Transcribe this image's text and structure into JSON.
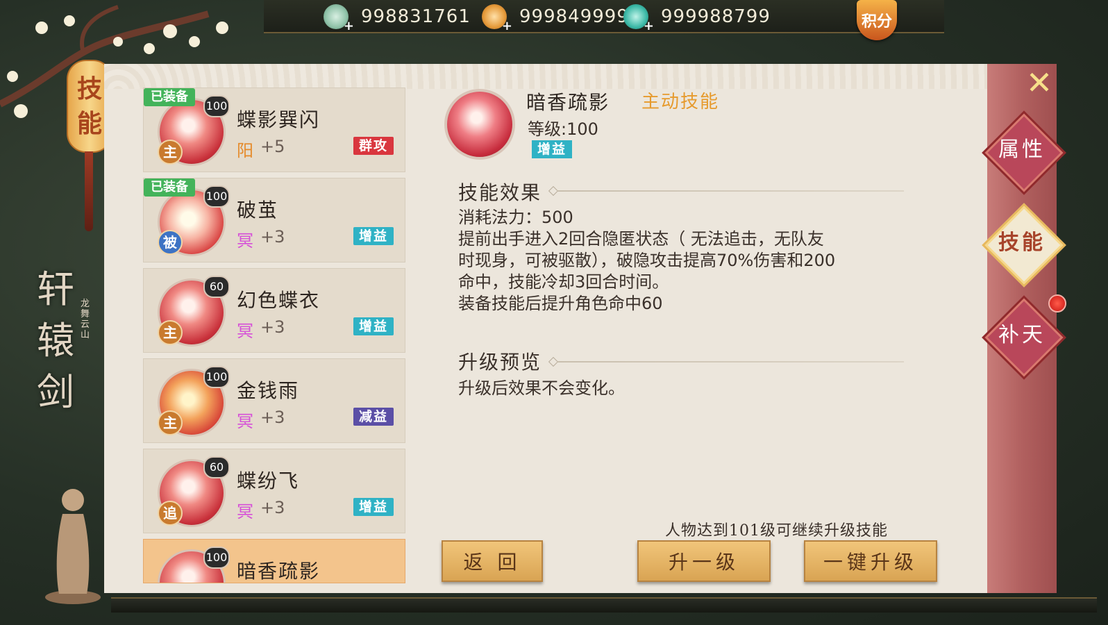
{
  "currencies": [
    {
      "value": "998831761",
      "color": "#8fc2a8"
    },
    {
      "value": "999849999",
      "color": "#e59a3a"
    },
    {
      "value": "999988799",
      "color": "#3bb8a6"
    }
  ],
  "top_badge": "积分",
  "lantern": [
    "技",
    "能"
  ],
  "logo": {
    "title": [
      "轩",
      "辕",
      "剑"
    ],
    "subtitle": "龙舞云山"
  },
  "side_tabs": [
    {
      "label": "属性",
      "active": false
    },
    {
      "label": "技能",
      "active": true
    },
    {
      "label": "补天",
      "active": false
    }
  ],
  "skills": [
    {
      "name": "蝶影巽闪",
      "level": "100",
      "equipped": "已装备",
      "type": "主",
      "element": "阳",
      "element_color": "#e58a2a",
      "bonus": "+5",
      "tag": "群攻",
      "tag_color": "#d9363e"
    },
    {
      "name": "破茧",
      "level": "100",
      "equipped": "已装备",
      "type": "被",
      "element": "冥",
      "element_color": "#d64fd8",
      "bonus": "+3",
      "tag": "增益",
      "tag_color": "#2fb2c5"
    },
    {
      "name": "幻色蝶衣",
      "level": "60",
      "equipped": "",
      "type": "主",
      "element": "冥",
      "element_color": "#d64fd8",
      "bonus": "+3",
      "tag": "增益",
      "tag_color": "#2fb2c5"
    },
    {
      "name": "金钱雨",
      "level": "100",
      "equipped": "",
      "type": "主",
      "element": "冥",
      "element_color": "#d64fd8",
      "bonus": "+3",
      "tag": "减益",
      "tag_color": "#5b4fa6"
    },
    {
      "name": "蝶纷飞",
      "level": "60",
      "equipped": "",
      "type": "追",
      "element": "冥",
      "element_color": "#d64fd8",
      "bonus": "+3",
      "tag": "增益",
      "tag_color": "#2fb2c5"
    },
    {
      "name": "暗香疏影",
      "level": "100",
      "equipped": "",
      "type": "",
      "element": "",
      "element_color": "",
      "bonus": "",
      "tag": "",
      "tag_color": ""
    }
  ],
  "detail": {
    "name": "暗香疏影",
    "kind": "主动技能",
    "level": "等级:100",
    "tag": "增益",
    "effect_title": "技能效果",
    "effect_lines": [
      "消耗法力：500",
      "提前出手进入2回合隐匿状态（ 无法追击，无队友",
      "时现身，可被驱散），破隐攻击提高70%伤害和200",
      "命中，技能冷却3回合时间。",
      "装备技能后提升角色命中60"
    ],
    "preview_title": "升级预览",
    "preview_text": "升级后效果不会变化。"
  },
  "requirement": "人物达到101级可继续升级技能",
  "buttons": {
    "back": "返 回",
    "upgrade": "升一级",
    "upgrade_all": "一键升级"
  },
  "close_symbol": "✕"
}
